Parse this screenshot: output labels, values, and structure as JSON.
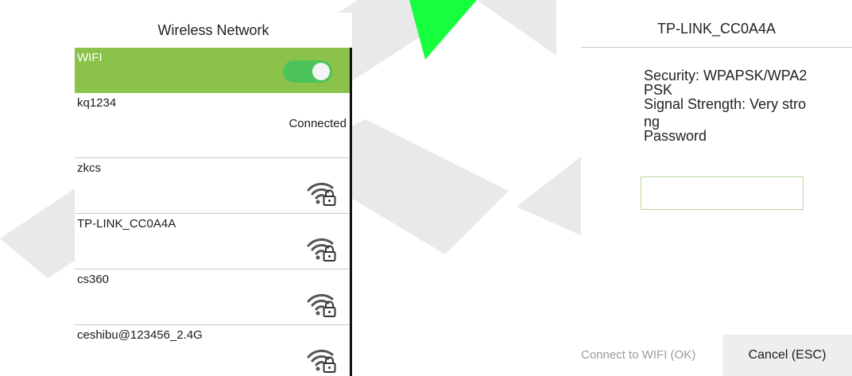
{
  "left_screen": {
    "title": "Wireless Network",
    "wifi_toggle": {
      "label": "WIFI",
      "enabled": true
    },
    "networks": [
      {
        "name": "kq1234",
        "status": "Connected"
      },
      {
        "name": "zkcs",
        "icon": "wifi-lock-icon"
      },
      {
        "name": "TP-LINK_CC0A4A",
        "icon": "wifi-lock-icon"
      },
      {
        "name": "cs360",
        "icon": "wifi-lock-icon"
      },
      {
        "name": "ceshibu@123456_2.4G",
        "icon": "wifi-lock-icon"
      }
    ]
  },
  "right_screen": {
    "title": "TP-LINK_CC0A4A",
    "security_line1": "Security:  WPAPSK/WPA2",
    "security_line2": "PSK",
    "signal_line1": "Signal Strength:  Very stro",
    "signal_line2": "ng",
    "password_label": "Password",
    "password_value": "",
    "connect_button": "Connect to WIFI (OK)",
    "cancel_button": "Cancel (ESC)"
  },
  "colors": {
    "accent_green": "#8bc34a",
    "toggle_on": "#4cc35a"
  }
}
